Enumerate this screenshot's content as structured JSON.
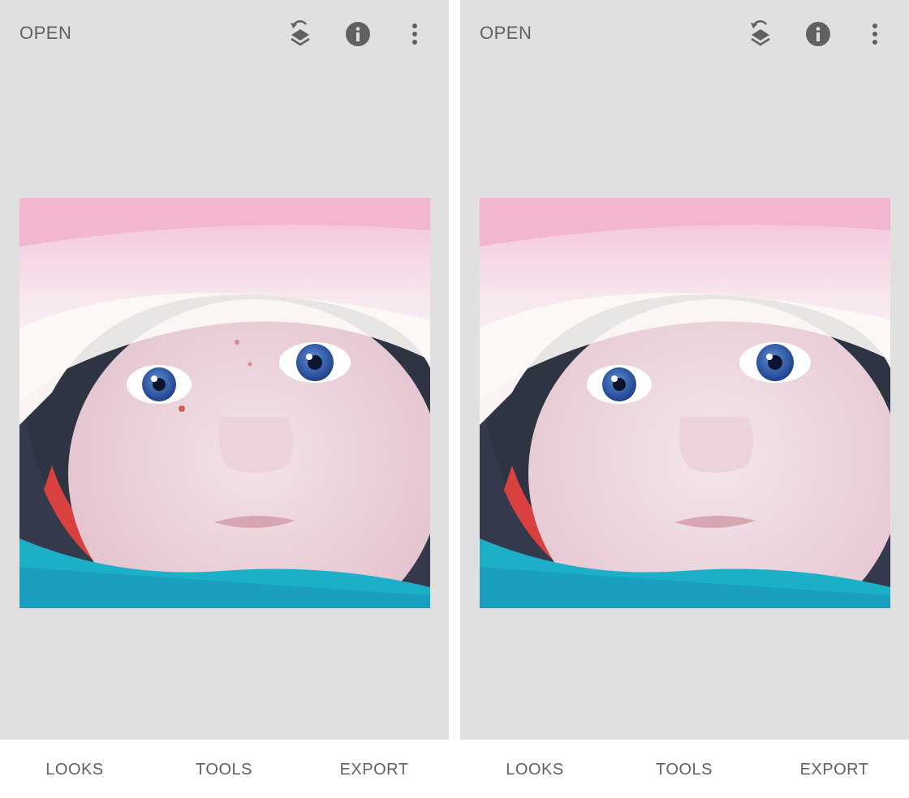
{
  "colors": {
    "canvas_bg": "#e0e0e0",
    "bar_bg": "#ffffff",
    "text": "#616161",
    "icon": "#616161"
  },
  "screens": [
    {
      "id": "before",
      "top_bar": {
        "open_label": "OPEN",
        "icons": [
          "stacks-icon",
          "info-icon",
          "more-vert-icon"
        ]
      },
      "photo": {
        "subject": "baby-in-pink-knit-hat",
        "retouched": false
      },
      "bottom_bar": {
        "looks_label": "LOOKS",
        "tools_label": "TOOLS",
        "export_label": "EXPORT"
      }
    },
    {
      "id": "after",
      "top_bar": {
        "open_label": "OPEN",
        "icons": [
          "stacks-icon",
          "info-icon",
          "more-vert-icon"
        ]
      },
      "photo": {
        "subject": "baby-in-pink-knit-hat",
        "retouched": true
      },
      "bottom_bar": {
        "looks_label": "LOOKS",
        "tools_label": "TOOLS",
        "export_label": "EXPORT"
      }
    }
  ]
}
